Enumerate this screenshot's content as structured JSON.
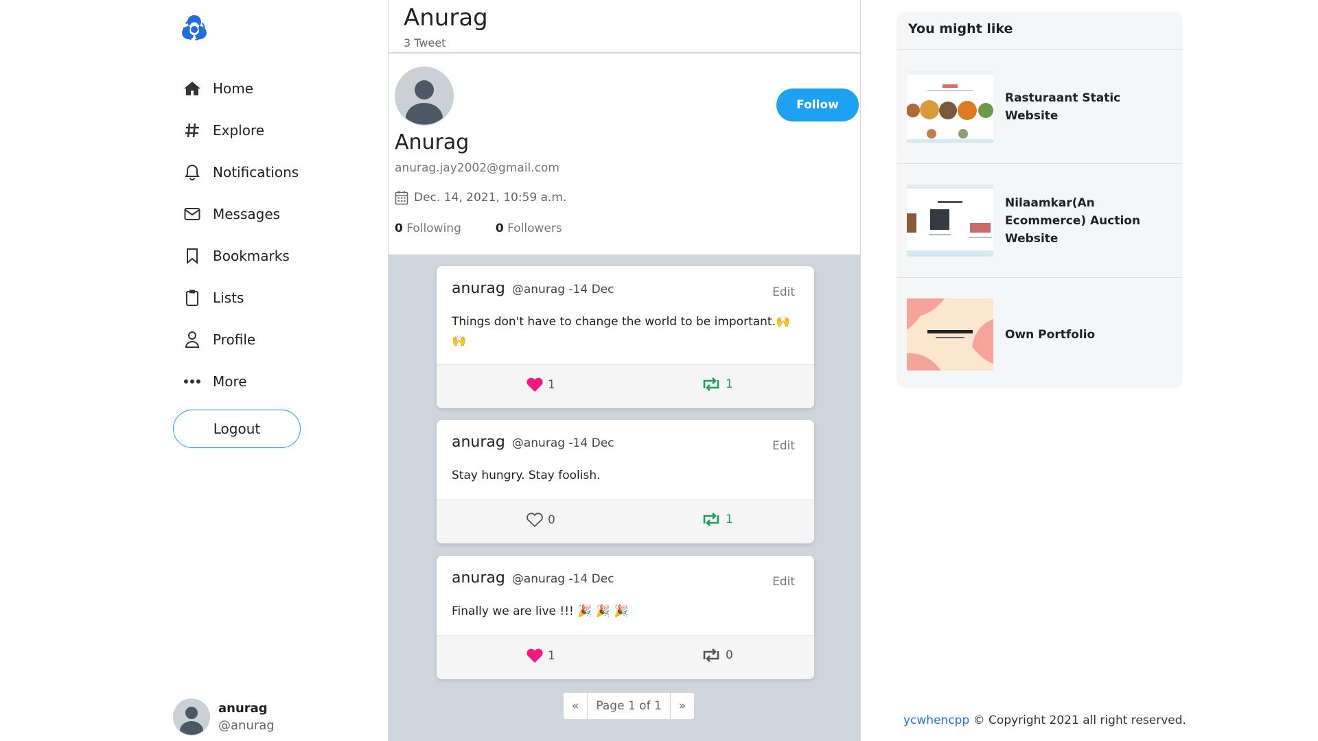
{
  "nav": {
    "items": [
      {
        "label": "Home",
        "icon": "home-icon"
      },
      {
        "label": "Explore",
        "icon": "hashtag-icon"
      },
      {
        "label": "Notifications",
        "icon": "bell-icon"
      },
      {
        "label": "Messages",
        "icon": "envelope-icon"
      },
      {
        "label": "Bookmarks",
        "icon": "bookmark-icon"
      },
      {
        "label": "Lists",
        "icon": "clipboard-icon"
      },
      {
        "label": "Profile",
        "icon": "user-icon"
      },
      {
        "label": "More",
        "icon": "more-icon"
      }
    ],
    "logout_label": "Logout"
  },
  "sidebar_user": {
    "name": "anurag",
    "handle": "@anurag"
  },
  "header": {
    "title": "Anurag",
    "tweet_count": "3 Tweet"
  },
  "profile": {
    "name": "Anurag",
    "email": "anurag.jay2002@gmail.com",
    "joined": "Dec. 14, 2021, 10:59 a.m.",
    "following_count": "0",
    "following_label": "Following",
    "followers_count": "0",
    "followers_label": "Followers",
    "follow_label": "Follow"
  },
  "tweets": [
    {
      "user": "anurag",
      "meta": "@anurag -14 Dec",
      "edit": "Edit",
      "text": "Things don't have to change the world to be important.🙌 🙌",
      "likes": "1",
      "liked": true,
      "retweets": "1",
      "retweeted": true
    },
    {
      "user": "anurag",
      "meta": "@anurag -14 Dec",
      "edit": "Edit",
      "text": "Stay hungry. Stay foolish.",
      "likes": "0",
      "liked": false,
      "retweets": "1",
      "retweeted": true
    },
    {
      "user": "anurag",
      "meta": "@anurag -14 Dec",
      "edit": "Edit",
      "text": "Finally we are live !!! 🎉 🎉 🎉",
      "likes": "1",
      "liked": true,
      "retweets": "0",
      "retweeted": false
    }
  ],
  "pagination": {
    "prev": "«",
    "label": "Page 1 of 1",
    "next": "»"
  },
  "suggestions": {
    "title": "You might like",
    "items": [
      {
        "name": "Rasturaant Static Website"
      },
      {
        "name": "Nilaamkar(An Ecommerce) Auction Website"
      },
      {
        "name": "Own Portfolio"
      }
    ]
  },
  "footer": {
    "link": "ycwhencpp",
    "text": " © Copyright 2021 all right reserved."
  },
  "colors": {
    "accent": "#1da1f2",
    "like": "#f91880",
    "retweet": "#17a05e",
    "feed_bg": "#cfd5dc"
  }
}
